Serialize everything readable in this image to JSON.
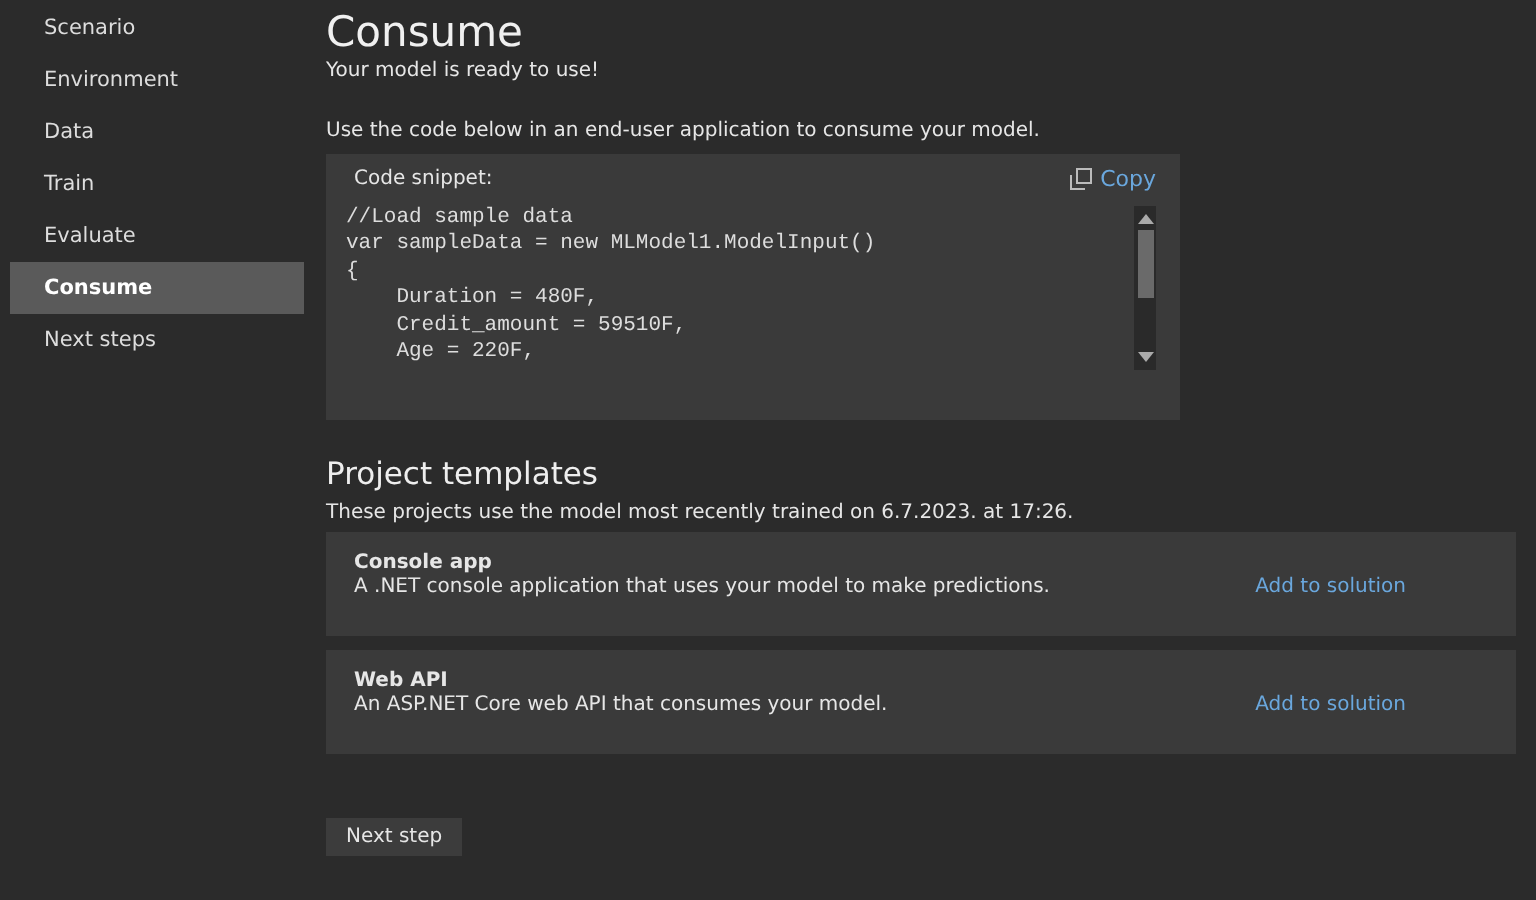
{
  "sidebar": {
    "items": [
      {
        "label": "Scenario",
        "selected": false
      },
      {
        "label": "Environment",
        "selected": false
      },
      {
        "label": "Data",
        "selected": false
      },
      {
        "label": "Train",
        "selected": false
      },
      {
        "label": "Evaluate",
        "selected": false
      },
      {
        "label": "Consume",
        "selected": true
      },
      {
        "label": "Next steps",
        "selected": false
      }
    ]
  },
  "header": {
    "title": "Consume",
    "subtitle": "Your model is ready to use!",
    "instruction": "Use the code below in an end-user application to consume your model."
  },
  "code_snippet": {
    "label": "Code snippet:",
    "copy": "Copy",
    "lines": [
      "//Load sample data",
      "var sampleData = new MLModel1.ModelInput()",
      "{",
      "    Duration = 480F,",
      "    Credit_amount = 59510F,",
      "    Age = 220F,"
    ]
  },
  "project_templates": {
    "heading": "Project templates",
    "note": "These projects use the model most recently trained on 6.7.2023. at 17:26.",
    "items": [
      {
        "name": "Console app",
        "description": "A .NET console application that uses your model to make predictions.",
        "action": "Add to solution"
      },
      {
        "name": "Web API",
        "description": "An ASP.NET Core web API that consumes your model.",
        "action": "Add to solution"
      }
    ]
  },
  "next_button": "Next step"
}
